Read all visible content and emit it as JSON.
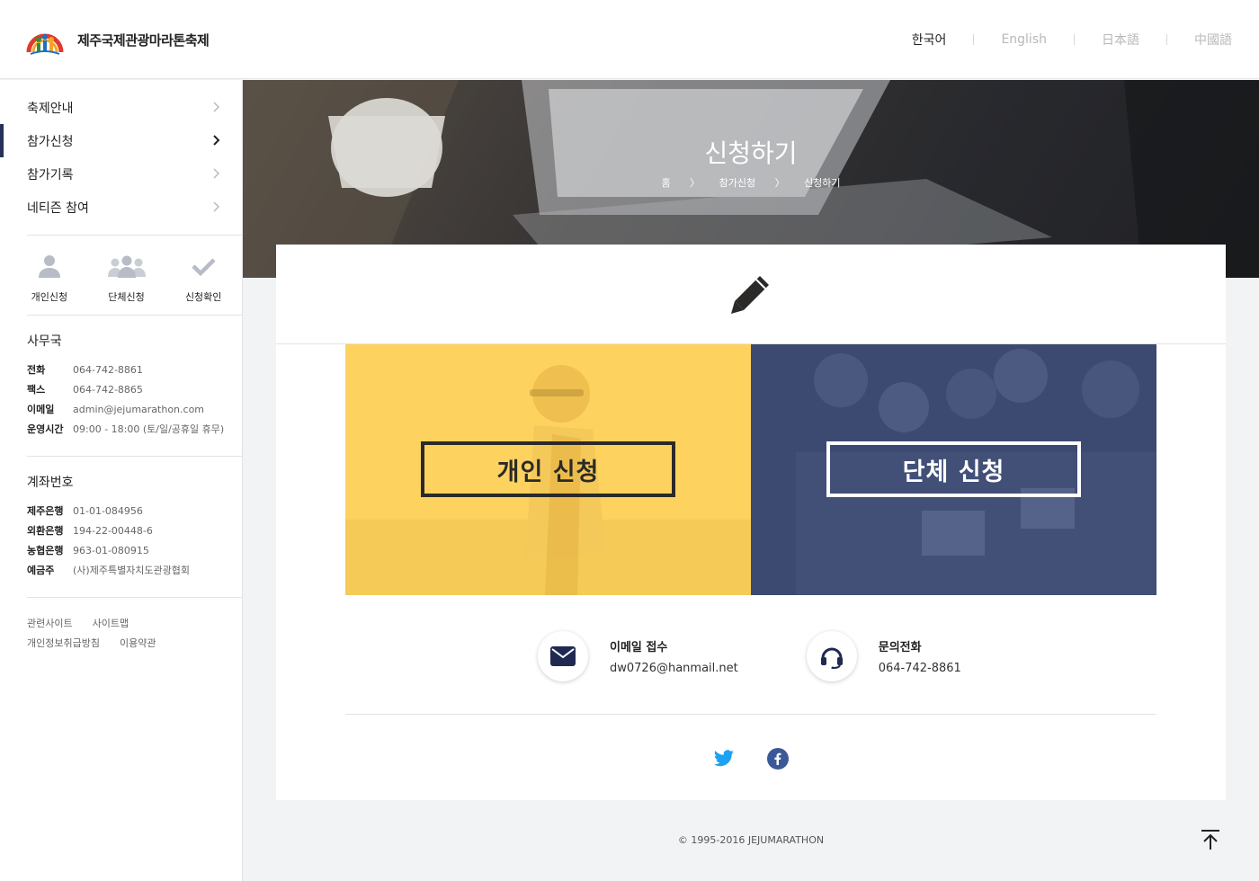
{
  "header": {
    "brand": "제주국제관광마라톤축제",
    "languages": [
      {
        "label": "한국어",
        "active": true
      },
      {
        "label": "English"
      },
      {
        "label": "日本語"
      },
      {
        "label": "中國語"
      }
    ]
  },
  "sidebar": {
    "nav": [
      {
        "label": "축제안내"
      },
      {
        "label": "참가신청",
        "active": true
      },
      {
        "label": "참가기록"
      },
      {
        "label": "네티즌 참여"
      }
    ],
    "quick": [
      {
        "label": "개인신청",
        "icon": "person-icon"
      },
      {
        "label": "단체신청",
        "icon": "group-icon"
      },
      {
        "label": "신청확인",
        "icon": "check-icon"
      }
    ],
    "office": {
      "title": "사무국",
      "rows": [
        {
          "k": "전화",
          "v": "064-742-8861"
        },
        {
          "k": "팩스",
          "v": "064-742-8865"
        },
        {
          "k": "이메일",
          "v": "admin@jejumarathon.com"
        },
        {
          "k": "운영시간",
          "v": "09:00 - 18:00 (토/일/공휴일 휴무)"
        }
      ]
    },
    "account": {
      "title": "계좌번호",
      "rows": [
        {
          "k": "제주은행",
          "v": "01-01-084956"
        },
        {
          "k": "외환은행",
          "v": "194-22-00448-6"
        },
        {
          "k": "농협은행",
          "v": "963-01-080915"
        },
        {
          "k": "예금주",
          "v": "(사)제주특별자치도관광협회"
        }
      ]
    },
    "links": [
      "관련사이트",
      "사이트맵",
      "개인정보취급방침",
      "이용약관"
    ]
  },
  "banner": {
    "title": "신청하기",
    "breadcrumb": [
      "홈",
      "참가신청",
      "신청하기"
    ],
    "separator": "〉"
  },
  "main": {
    "tiles": [
      {
        "label": "개인 신청",
        "color": "#fdd25f"
      },
      {
        "label": "단체 신청",
        "color": "#3c4a72"
      }
    ],
    "contacts": [
      {
        "label": "이메일 접수",
        "value": "dw0726@hanmail.net",
        "icon": "mail-icon"
      },
      {
        "label": "문의전화",
        "value": "064-742-8861",
        "icon": "headset-icon"
      }
    ],
    "social": [
      "twitter-icon",
      "facebook-icon"
    ]
  },
  "footer": {
    "copyright": "© 1995-2016 JEJUMARATHON"
  }
}
